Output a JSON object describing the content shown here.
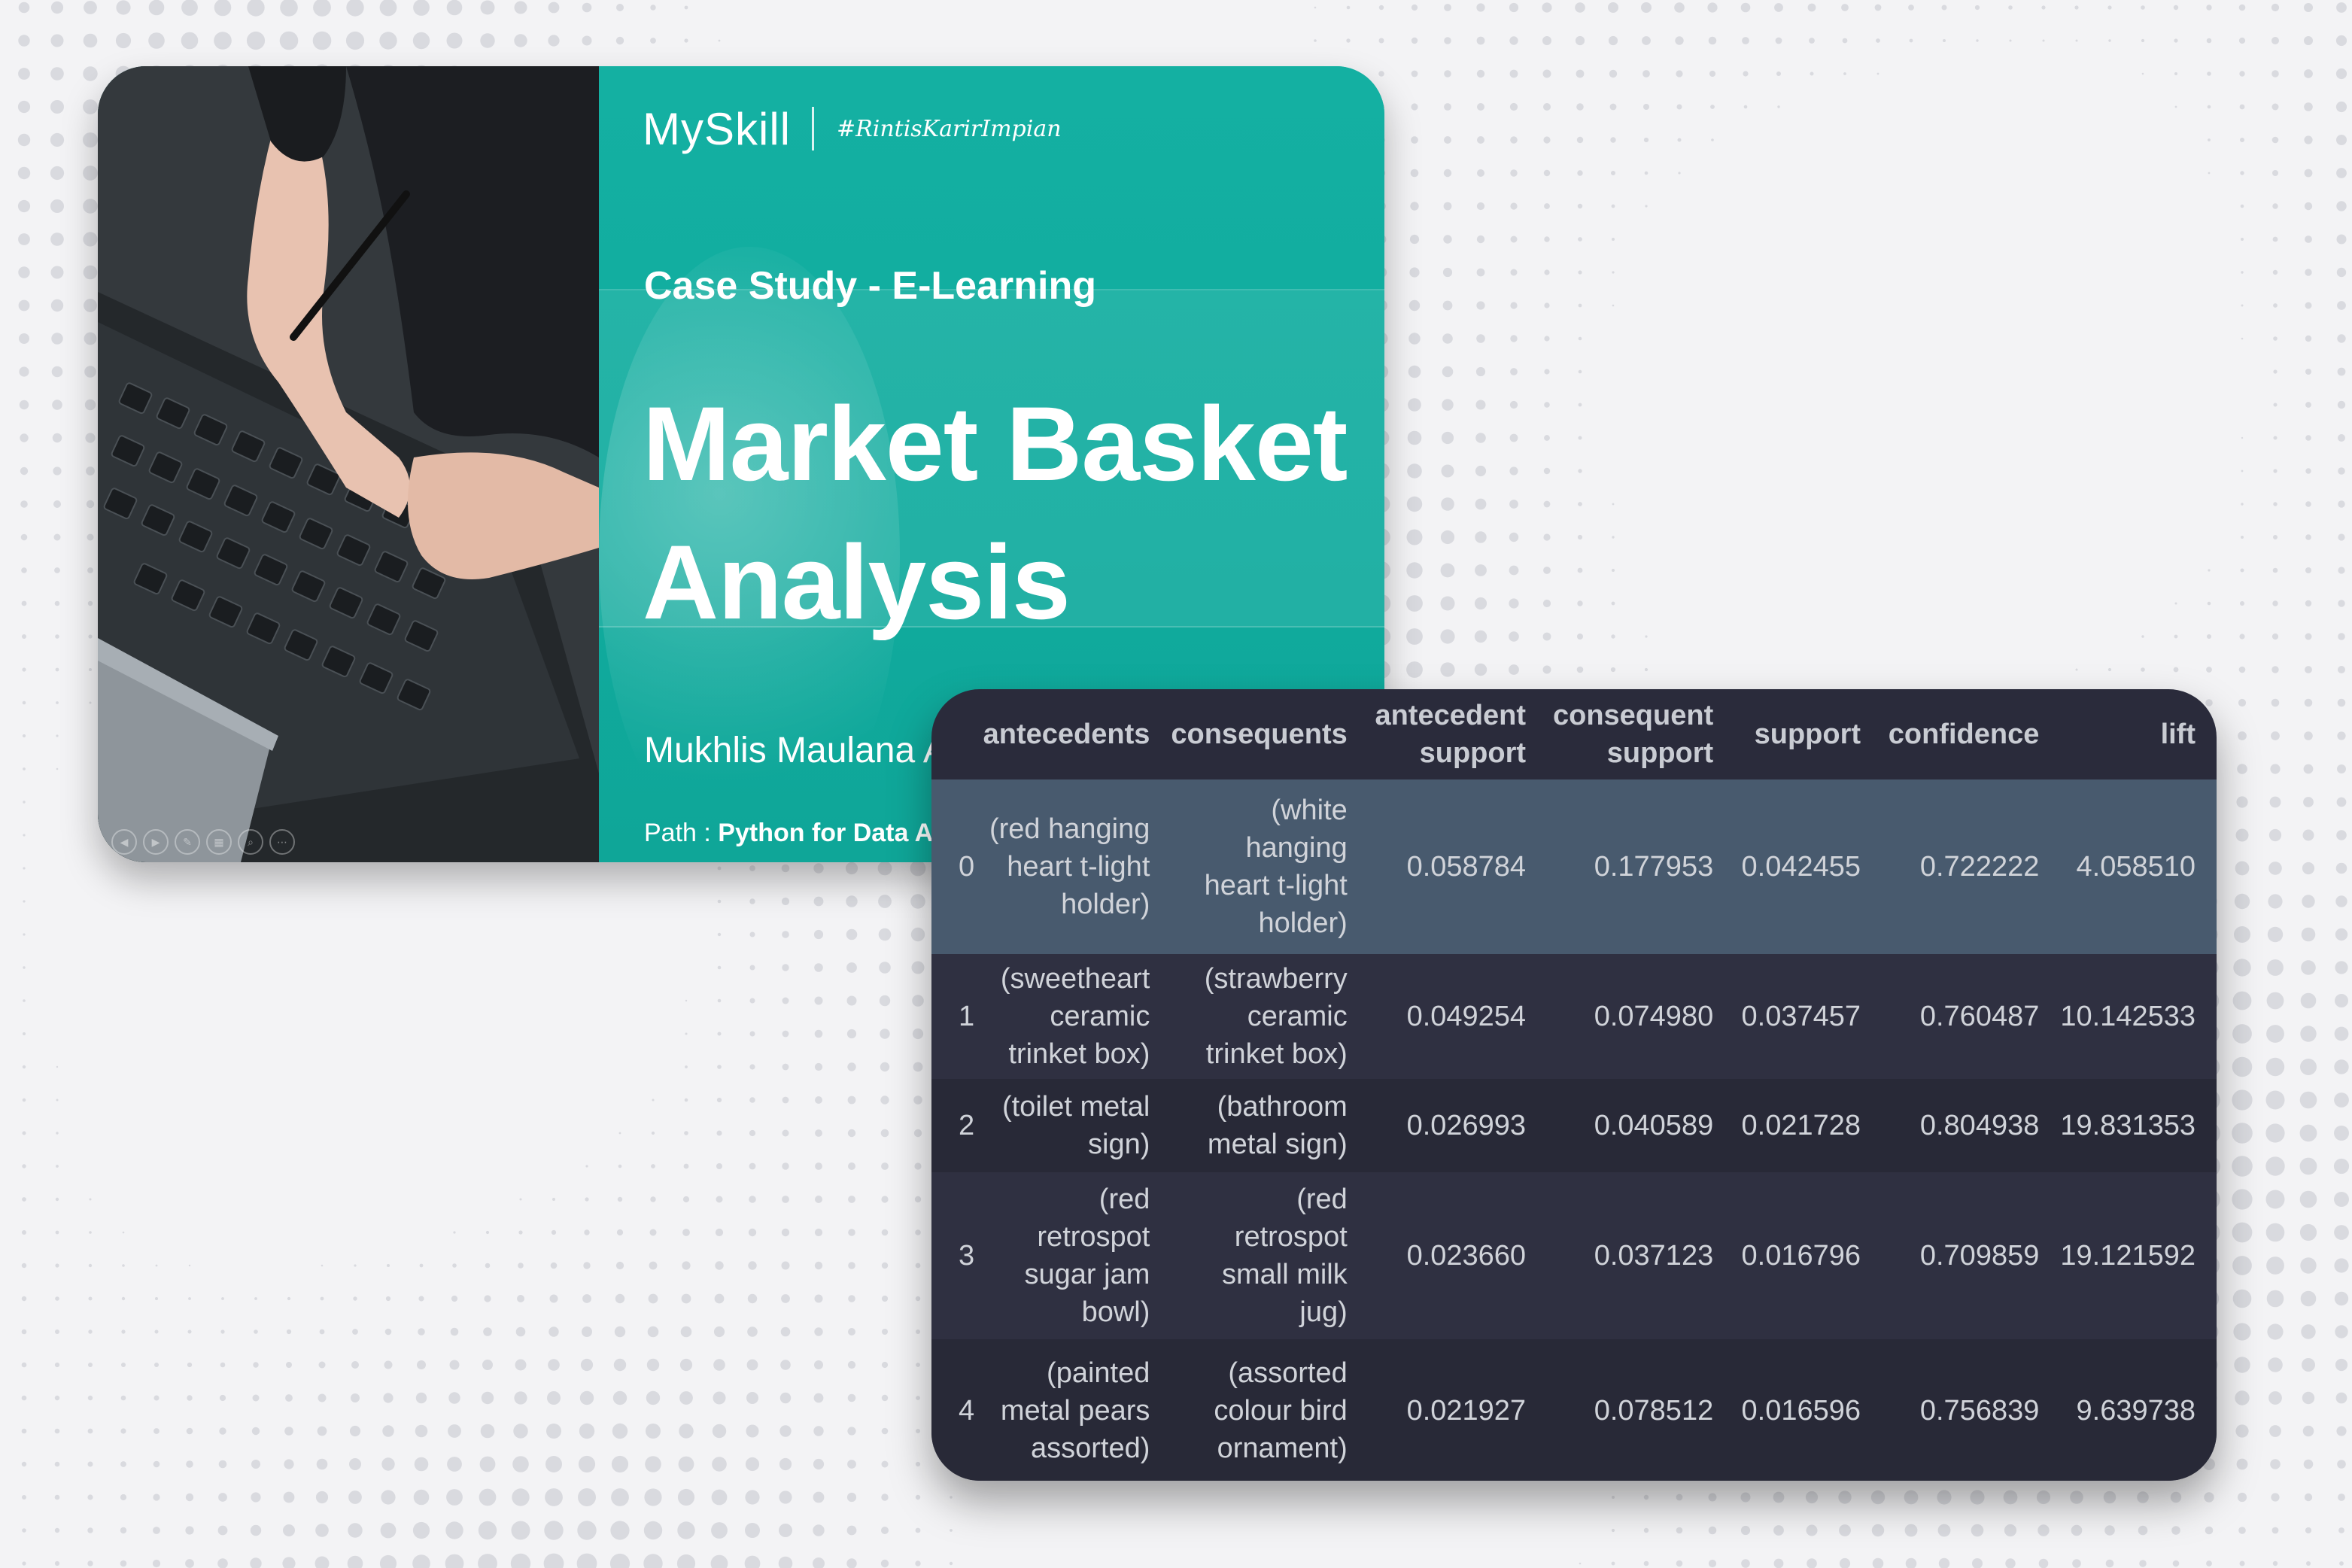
{
  "slide": {
    "brand": "MySkill",
    "hashtag": "#RintisKarirImpian",
    "case_study": "Case Study - E-Learning",
    "title_line1": "Market Basket",
    "title_line2": "Analysis",
    "author": "Mukhlis Maulana Al Fakih",
    "path_label": "Path : ",
    "path_value": "Python for Data A"
  },
  "table": {
    "headers": {
      "antecedents": "antecedents",
      "consequents": "consequents",
      "antecedent_support_1": "antecedent",
      "antecedent_support_2": "support",
      "consequent_support_1": "consequent",
      "consequent_support_2": "support",
      "support": "support",
      "confidence": "confidence",
      "lift": "lift"
    },
    "rows": [
      {
        "index": "0",
        "antecedents": [
          "(red hanging",
          "heart t-light",
          "holder)"
        ],
        "consequents": [
          "(white",
          "hanging",
          "heart t-light",
          "holder)"
        ],
        "antecedent_support": "0.058784",
        "consequent_support": "0.177953",
        "support": "0.042455",
        "confidence": "0.722222",
        "lift": "4.058510"
      },
      {
        "index": "1",
        "antecedents": [
          "(sweetheart",
          "ceramic",
          "trinket box)"
        ],
        "consequents": [
          "(strawberry",
          "ceramic",
          "trinket box)"
        ],
        "antecedent_support": "0.049254",
        "consequent_support": "0.074980",
        "support": "0.037457",
        "confidence": "0.760487",
        "lift": "10.142533"
      },
      {
        "index": "2",
        "antecedents": [
          "(toilet metal",
          "sign)"
        ],
        "consequents": [
          "(bathroom",
          "metal sign)"
        ],
        "antecedent_support": "0.026993",
        "consequent_support": "0.040589",
        "support": "0.021728",
        "confidence": "0.804938",
        "lift": "19.831353"
      },
      {
        "index": "3",
        "antecedents": [
          "(red",
          "retrospot",
          "sugar jam",
          "bowl)"
        ],
        "consequents": [
          "(red",
          "retrospot",
          "small milk",
          "jug)"
        ],
        "antecedent_support": "0.023660",
        "consequent_support": "0.037123",
        "support": "0.016796",
        "confidence": "0.709859",
        "lift": "19.121592"
      },
      {
        "index": "4",
        "antecedents": [
          "(painted",
          "metal pears",
          "assorted)"
        ],
        "consequents": [
          "(assorted",
          "colour bird",
          "ornament)"
        ],
        "antecedent_support": "0.021927",
        "consequent_support": "0.078512",
        "support": "0.016596",
        "confidence": "0.756839",
        "lift": "9.639738"
      }
    ]
  }
}
